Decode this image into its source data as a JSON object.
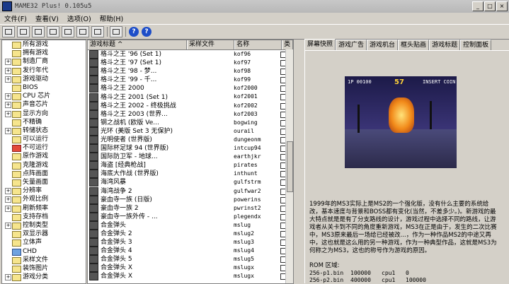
{
  "window": {
    "title": "MAME32 Plus! 0.105u5",
    "btn_min": "_",
    "btn_max": "□",
    "btn_close": "×"
  },
  "menu": [
    "文件(F)",
    "查看(V)",
    "选项(O)",
    "帮助(H)"
  ],
  "toolbar": {
    "help_glyph": "?",
    "info_glyph": "?"
  },
  "tree": [
    {
      "label": "所有游戏",
      "exp": "",
      "folder": "yellow"
    },
    {
      "label": "拥有游戏",
      "exp": "",
      "folder": "yellow"
    },
    {
      "label": "制造厂商",
      "exp": "+",
      "folder": "yellow"
    },
    {
      "label": "发行年代",
      "exp": "+",
      "folder": "yellow"
    },
    {
      "label": "游戏驱动",
      "exp": "+",
      "folder": "yellow"
    },
    {
      "label": "BIOS",
      "exp": "",
      "folder": "yellow"
    },
    {
      "label": "CPU 芯片",
      "exp": "+",
      "folder": "yellow"
    },
    {
      "label": "声音芯片",
      "exp": "+",
      "folder": "yellow"
    },
    {
      "label": "显示方向",
      "exp": "+",
      "folder": "yellow"
    },
    {
      "label": "不精确",
      "exp": "",
      "folder": "yellow"
    },
    {
      "label": "转储状态",
      "exp": "+",
      "folder": "yellow"
    },
    {
      "label": "可以运行",
      "exp": "",
      "folder": "yellow"
    },
    {
      "label": "不可运行",
      "exp": "",
      "folder": "red"
    },
    {
      "label": "原作游戏",
      "exp": "",
      "folder": "yellow"
    },
    {
      "label": "克隆游戏",
      "exp": "",
      "folder": "yellow"
    },
    {
      "label": "点阵画面",
      "exp": "",
      "folder": "yellow"
    },
    {
      "label": "矢量画面",
      "exp": "",
      "folder": "yellow"
    },
    {
      "label": "分辨率",
      "exp": "+",
      "folder": "yellow"
    },
    {
      "label": "外观比例",
      "exp": "+",
      "folder": "yellow"
    },
    {
      "label": "刷新频率",
      "exp": "+",
      "folder": "yellow"
    },
    {
      "label": "支持存档",
      "exp": "",
      "folder": "yellow"
    },
    {
      "label": "控制类型",
      "exp": "+",
      "folder": "yellow"
    },
    {
      "label": "双显示器",
      "exp": "",
      "folder": "yellow"
    },
    {
      "label": "立体声",
      "exp": "",
      "folder": "yellow"
    },
    {
      "label": "CHD",
      "exp": "",
      "folder": "blue"
    },
    {
      "label": "采样文件",
      "exp": "",
      "folder": "yellow"
    },
    {
      "label": "装饰图片",
      "exp": "",
      "folder": "yellow"
    },
    {
      "label": "游戏分类",
      "exp": "+",
      "folder": "yellow"
    }
  ],
  "list": {
    "headers": [
      "游戏标题 ^",
      "采样文件",
      "名称",
      "类"
    ],
    "rows": [
      {
        "title": "格斗之王 '96 (Set 1)",
        "name": "kof96"
      },
      {
        "title": "格斗之王 '97 (Set 1)",
        "name": "kof97"
      },
      {
        "title": "格斗之王 '98 - 梦...",
        "name": "kof98"
      },
      {
        "title": "格斗之王 '99 - 千...",
        "name": "kof99"
      },
      {
        "title": "格斗之王 2000",
        "name": "kof2000"
      },
      {
        "title": "格斗之王 2001 (Set 1)",
        "name": "kof2001"
      },
      {
        "title": "格斗之王 2002 - 终极挑战",
        "name": "kof2002"
      },
      {
        "title": "格斗之王 2003 (世界...",
        "name": "kof2003"
      },
      {
        "title": "钢之战机 (欧版 Ve...",
        "name": "bogwing"
      },
      {
        "title": "光环 (美版 Set 3 无保护)",
        "name": "ourail"
      },
      {
        "title": "光明使者 (世界版)",
        "name": "dungeonm"
      },
      {
        "title": "国际杯足球 94 (世界版)",
        "name": "intcup94"
      },
      {
        "title": "国际防卫军 - 地球...",
        "name": "earthjkr"
      },
      {
        "title": "海盗 [经典枪战]",
        "name": "pirates"
      },
      {
        "title": "海底大作战 (世界版)",
        "name": "inthunt"
      },
      {
        "title": "海湾风暴",
        "name": "gulfstrm"
      },
      {
        "title": "海湾战争 2",
        "name": "gulfwar2"
      },
      {
        "title": "豪血寺一族 (日版)",
        "name": "powerins"
      },
      {
        "title": "豪血寺一族 2",
        "name": "pwrinst2"
      },
      {
        "title": "豪血寺一族外传 - ...",
        "name": "plegendx"
      },
      {
        "title": "合金弹头",
        "name": "mslug"
      },
      {
        "title": "合金弹头 2",
        "name": "mslug2"
      },
      {
        "title": "合金弹头 3",
        "name": "mslug3"
      },
      {
        "title": "合金弹头 4",
        "name": "mslug4"
      },
      {
        "title": "合金弹头 5",
        "name": "mslug5"
      },
      {
        "title": "合金弹头 X",
        "name": "mslugx"
      },
      {
        "title": "合金弹头 X",
        "name": "mslugx"
      }
    ]
  },
  "tabs": [
    "屏幕快照",
    "游戏广告",
    "游戏机台",
    "框头贴画",
    "游戏标题",
    "控制面板"
  ],
  "snapshot": {
    "hud_left": "1P 00100",
    "hud_right": "INSERT COIN",
    "timer": "57"
  },
  "info_text": "1999年的MS3实际上是MS2的一个强化版，没有什么主要的系统给改，基本速度与背景和BOSS都有变化(当然，不差多少。)。新游戏的最大特点就是是有了分支路线的设计，游戏过程中选择不同的路线，让游戏者从关卡到不同的角度重新游戏，MS3在正是由于，发生的二次比赛中，MS3原来最后一场给已经被改...，作为一种作品MS2的中途又再中，这也就是这么用的另一种游戏，作为一种典型作品，这就是MS3为何称之为MS3，这也的称号作为游戏的原因。",
  "rom_header": "ROM 区域:",
  "roms": [
    {
      "file": "256-p1.bin",
      "size": "100000",
      "region": "cpu1",
      "offset": "0"
    },
    {
      "file": "256-p2.bin",
      "size": "400000",
      "region": "cpu1",
      "offset": "100000"
    }
  ]
}
